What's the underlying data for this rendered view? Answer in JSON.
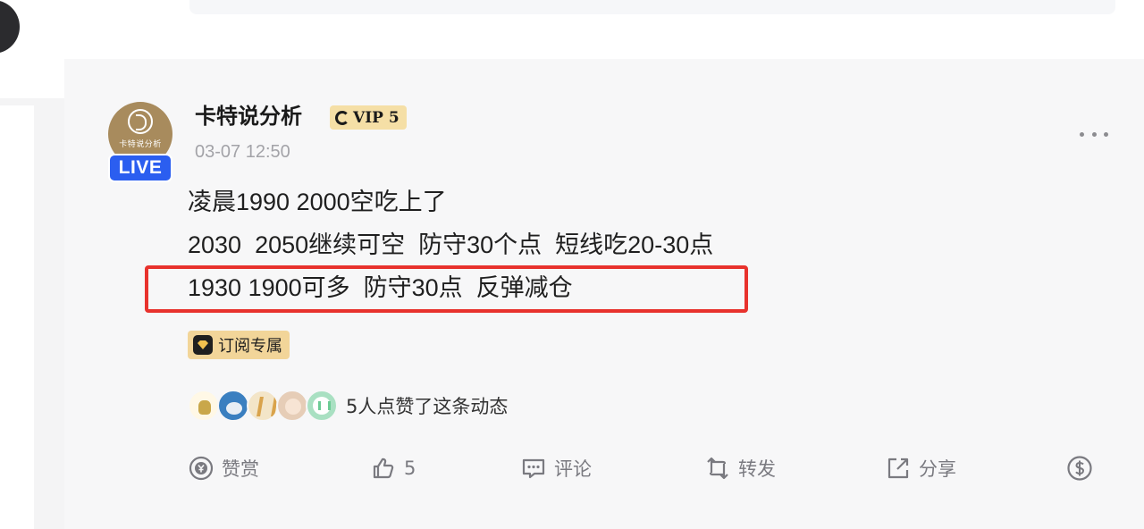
{
  "post": {
    "author": {
      "name": "卡特说分析",
      "avatar_text": "卡特说分析",
      "live_label": "LIVE",
      "vip_label": "VIP 5"
    },
    "time": "03-07 12:50",
    "content": {
      "line1": "凌晨1990 2000空吃上了",
      "line2": "2030  2050继续可空  防守30个点  短线吃20-30点",
      "line3": "1930 1900可多  防守30点  反弹减仓"
    },
    "tag": "订阅专属",
    "likes_text": "5人点赞了这条动态",
    "actions": {
      "reward": "赞赏",
      "like_count": "5",
      "comment": "评论",
      "repost": "转发",
      "share": "分享"
    }
  },
  "icons": {
    "reward": "yen-coin-icon",
    "like": "thumbs-up-icon",
    "comment": "comment-icon",
    "repost": "repost-icon",
    "share": "share-icon",
    "dollar": "dollar-coin-icon",
    "more": "more-icon"
  },
  "colors": {
    "live_badge": "#2b5ef0",
    "vip_badge": "#f5dfa6",
    "highlight_border": "#e8322d",
    "tag_bg": "#f2d599"
  }
}
